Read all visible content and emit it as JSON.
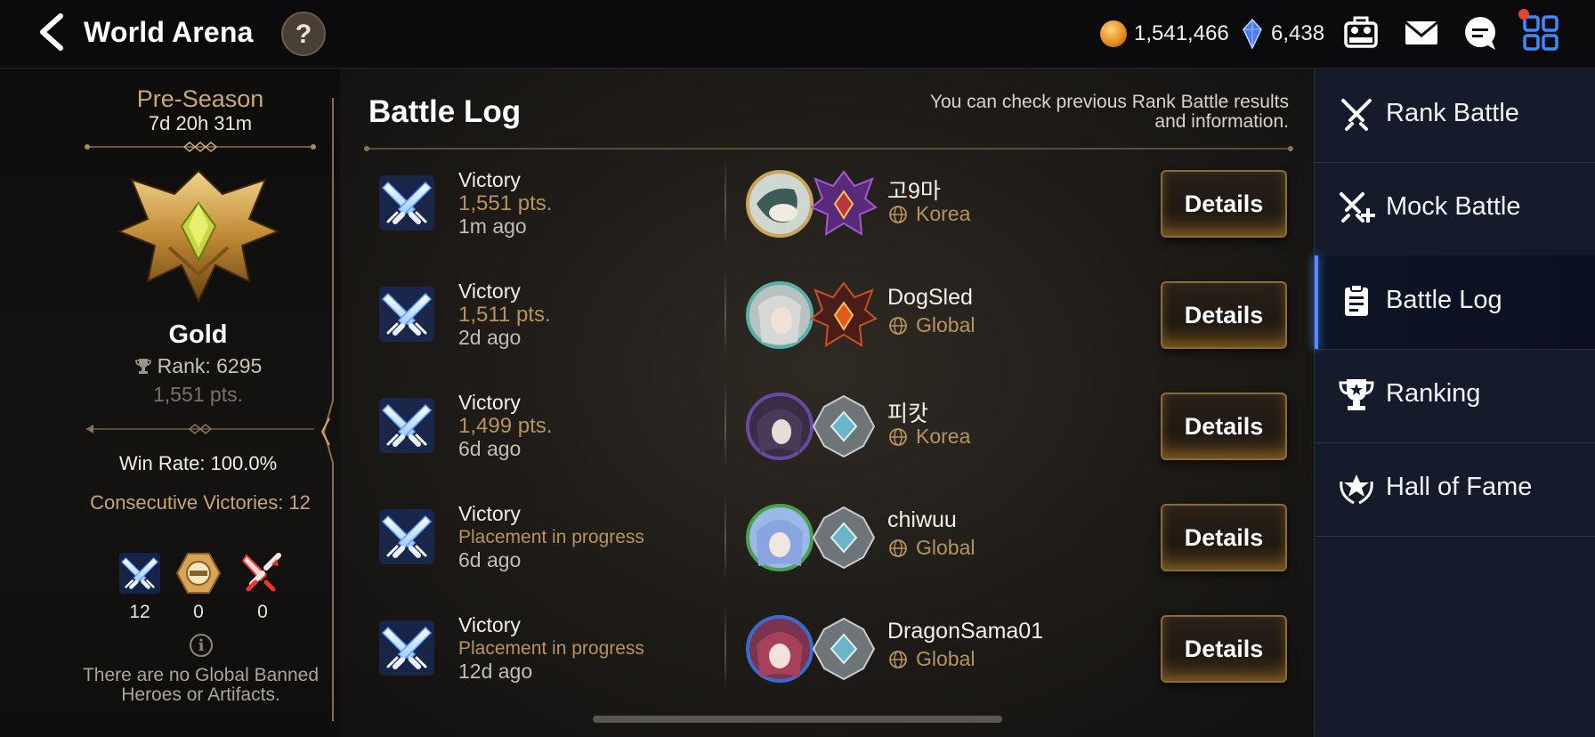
{
  "header": {
    "title": "World Arena",
    "help_label": "?",
    "gold": "1,541,466",
    "crystals": "6,438"
  },
  "profile": {
    "season": "Pre-Season",
    "timer": "7d 20h 31m",
    "tier": "Gold",
    "rank": "Rank: 6295",
    "points": "1,551 pts.",
    "win_rate": "Win Rate: 100.0%",
    "consecutive": "Consecutive Victories: 12",
    "wins": "12",
    "draws": "0",
    "losses": "0",
    "banned_notice": "There are no Global Banned Heroes or Artifacts."
  },
  "battle_log": {
    "title": "Battle Log",
    "description": "You can check previous Rank Battle results and information.",
    "entries": [
      {
        "result": "Victory",
        "points": "1,551 pts.",
        "ago": "1m ago",
        "player": "고9마",
        "server": "Korea",
        "details": "Details"
      },
      {
        "result": "Victory",
        "points": "1,511 pts.",
        "ago": "2d ago",
        "player": "DogSled",
        "server": "Global",
        "details": "Details"
      },
      {
        "result": "Victory",
        "points": "1,499 pts.",
        "ago": "6d ago",
        "player": "피캇",
        "server": "Korea",
        "details": "Details"
      },
      {
        "result": "Victory",
        "points": "Placement in progress",
        "ago": "6d ago",
        "player": "chiwuu",
        "server": "Global",
        "details": "Details"
      },
      {
        "result": "Victory",
        "points": "Placement in progress",
        "ago": "12d ago",
        "player": "DragonSama01",
        "server": "Global",
        "details": "Details"
      }
    ]
  },
  "menu": {
    "items": [
      {
        "label": "Rank Battle"
      },
      {
        "label": "Mock Battle"
      },
      {
        "label": "Battle Log"
      },
      {
        "label": "Ranking"
      },
      {
        "label": "Hall of Fame"
      }
    ]
  },
  "colors": {
    "accent_gold": "#b7945f",
    "active_blue": "#4f8cff",
    "menu_bg": "#141c2c"
  }
}
